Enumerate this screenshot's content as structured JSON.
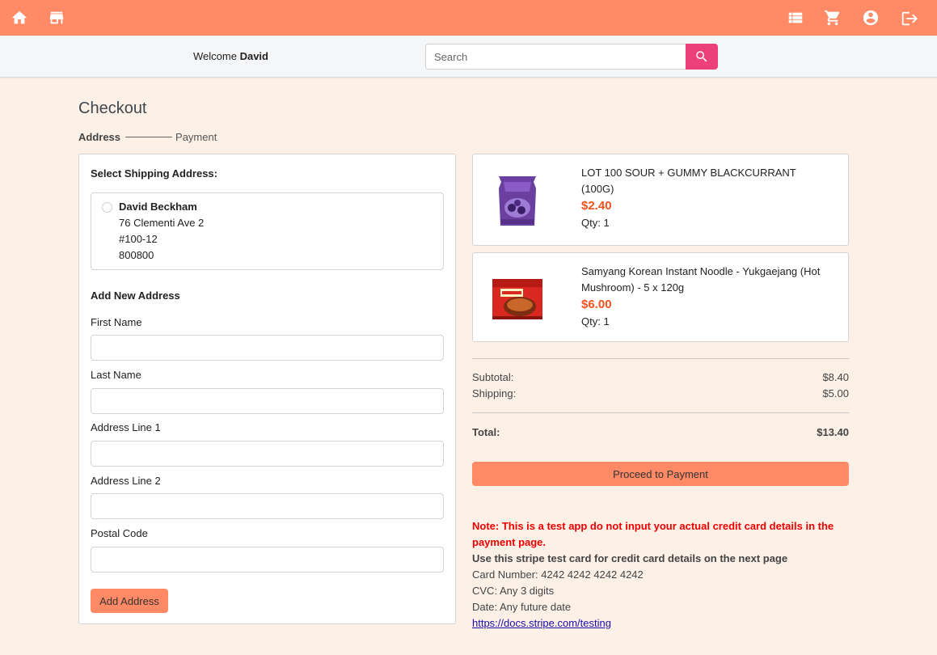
{
  "topbar": {
    "icons": [
      "home-icon",
      "store-icon",
      "orders-icon",
      "cart-icon",
      "account-icon",
      "logout-icon"
    ],
    "bg_color": "#ff8a65"
  },
  "header": {
    "welcome_prefix": "Welcome",
    "user_name": "David",
    "search_placeholder": "Search",
    "search_button_color": "#ec407a"
  },
  "checkout": {
    "title": "Checkout",
    "steps": [
      "Address",
      "Payment"
    ],
    "active_step": "Address"
  },
  "shipping": {
    "section_title": "Select Shipping Address:",
    "saved_address": {
      "name": "David Beckham",
      "line1": "76 Clementi Ave 2",
      "line2": "#100-12",
      "postal": "800800"
    }
  },
  "new_address": {
    "title": "Add New Address",
    "fields": [
      "First Name",
      "Last Name",
      "Address Line 1",
      "Address Line 2",
      "Postal Code"
    ],
    "button_label": "Add Address"
  },
  "cart": {
    "items": [
      {
        "name": "LOT 100 SOUR + GUMMY BLACKCURRANT (100G)",
        "price": "$2.40",
        "qty": "Qty: 1",
        "image": "gummy-pack-image"
      },
      {
        "name": "Samyang Korean Instant Noodle - Yukgaejang (Hot Mushroom) - 5 x 120g",
        "price": "$6.00",
        "qty": "Qty: 1",
        "image": "noodle-pack-image"
      }
    ],
    "price_color": "#f4511e"
  },
  "summary": {
    "subtotal_label": "Subtotal:",
    "subtotal": "$8.40",
    "shipping_label": "Shipping:",
    "shipping": "$5.00",
    "total_label": "Total:",
    "total": "$13.40"
  },
  "proceed_label": "Proceed to Payment",
  "note": {
    "warning": "Note: This is a test app do not input your actual credit card details in the payment page.",
    "instruction": "Use this stripe test card for credit card details on the next page",
    "card_number": "Card Number: 4242 4242 4242 4242",
    "cvc": "CVC: Any 3 digits",
    "date": "Date: Any future date",
    "link": "https://docs.stripe.com/testing"
  }
}
